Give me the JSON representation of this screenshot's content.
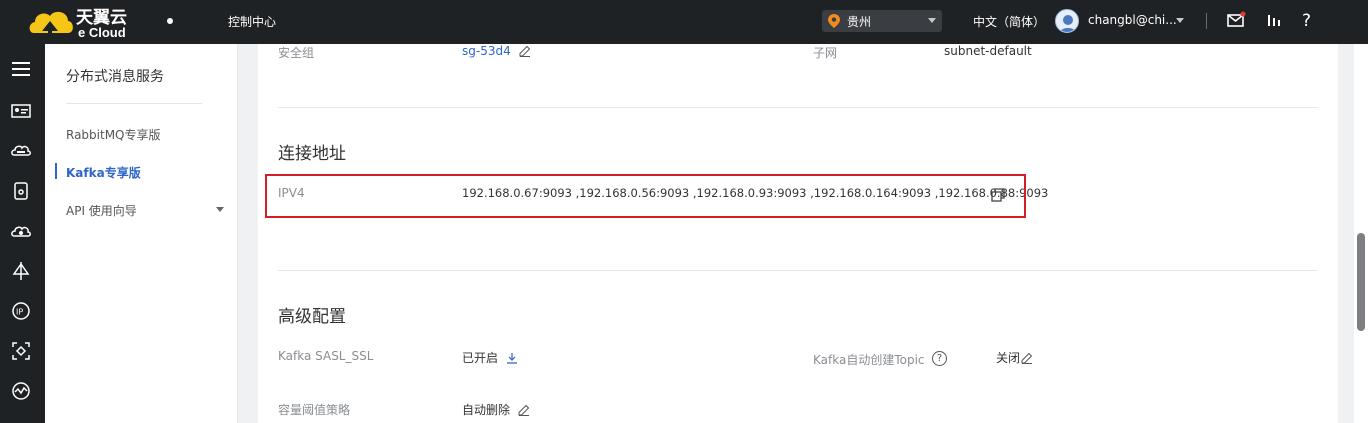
{
  "header": {
    "logo_text_cn": "天翼云",
    "logo_text_en": "e Cloud",
    "console_label": "控制中心",
    "region": "贵州",
    "language": "中文（简体）",
    "username": "changbl@chi..."
  },
  "sidebar": {
    "service_title": "分布式消息服务",
    "items": [
      {
        "label": "RabbitMQ专享版"
      },
      {
        "label": "Kafka专享版"
      },
      {
        "label": "API 使用向导"
      }
    ]
  },
  "main": {
    "security_group_label": "安全组",
    "security_group_value": "sg-53d4",
    "subnet_label": "子网",
    "subnet_value": "subnet-default",
    "connection_title": "连接地址",
    "ipv4_label": "IPV4",
    "ipv4_value": "192.168.0.67:9093 ,192.168.0.56:9093 ,192.168.0.93:9093 ,192.168.0.164:9093 ,192.168.0.88:9093",
    "advanced_title": "高级配置",
    "sasl_label": "Kafka SASL_SSL",
    "sasl_value": "已开启",
    "auto_topic_label": "Kafka自动创建Topic",
    "auto_topic_value": "关闭",
    "capacity_label": "容量阈值策略",
    "capacity_value": "自动删除"
  },
  "colors": {
    "topbar": "#1f2225",
    "accent": "#2f65c8",
    "highlight": "#d31d28"
  }
}
